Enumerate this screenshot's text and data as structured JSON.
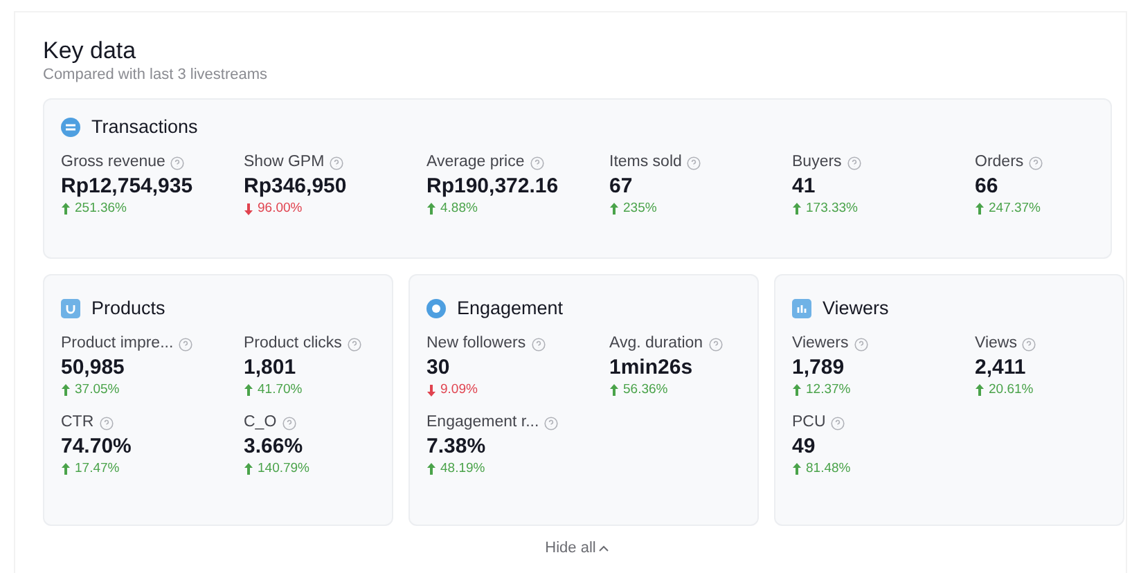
{
  "title": "Key data",
  "subtitle": "Compared with last 3 livestreams",
  "sections": [
    {
      "title": "Transactions",
      "metrics": [
        {
          "label": "Gross revenue",
          "value": "Rp12,754,935",
          "change": "251.36%",
          "kind": "up"
        },
        {
          "label": "Show GPM",
          "value": "Rp346,950",
          "change": "96.00%",
          "kind": "down"
        },
        {
          "label": "Average price",
          "value": "Rp190,372.16",
          "change": "4.88%",
          "kind": "up"
        },
        {
          "label": "Items sold",
          "value": "67",
          "change": "235%",
          "kind": "up"
        },
        {
          "label": "Buyers",
          "value": "41",
          "change": "173.33%",
          "kind": "up"
        },
        {
          "label": "Orders",
          "value": "66",
          "change": "247.37%",
          "kind": "up"
        }
      ]
    },
    {
      "title": "Products",
      "metrics": [
        {
          "label": "Product impre...",
          "value": "50,985",
          "change": "37.05%",
          "kind": "up"
        },
        {
          "label": "Product clicks",
          "value": "1,801",
          "change": "41.70%",
          "kind": "up"
        },
        {
          "label": "CTR",
          "value": "74.70%",
          "change": "17.47%",
          "kind": "up"
        },
        {
          "label": "C_O",
          "value": "3.66%",
          "change": "140.79%",
          "kind": "up"
        }
      ]
    },
    {
      "title": "Engagement",
      "metrics": [
        {
          "label": "New followers",
          "value": "30",
          "change": "9.09%",
          "kind": "down"
        },
        {
          "label": "Avg. duration",
          "value": "1min26s",
          "change": "56.36%",
          "kind": "up"
        },
        {
          "label": "Engagement r...",
          "value": "7.38%",
          "change": "48.19%",
          "kind": "up"
        }
      ]
    },
    {
      "title": "Viewers",
      "metrics": [
        {
          "label": "Viewers",
          "value": "1,789",
          "change": "12.37%",
          "kind": "up"
        },
        {
          "label": "Views",
          "value": "2,411",
          "change": "20.61%",
          "kind": "up"
        },
        {
          "label": "PCU",
          "value": "49",
          "change": "81.48%",
          "kind": "up"
        }
      ]
    }
  ],
  "toggle": {
    "label": "Hide all"
  }
}
